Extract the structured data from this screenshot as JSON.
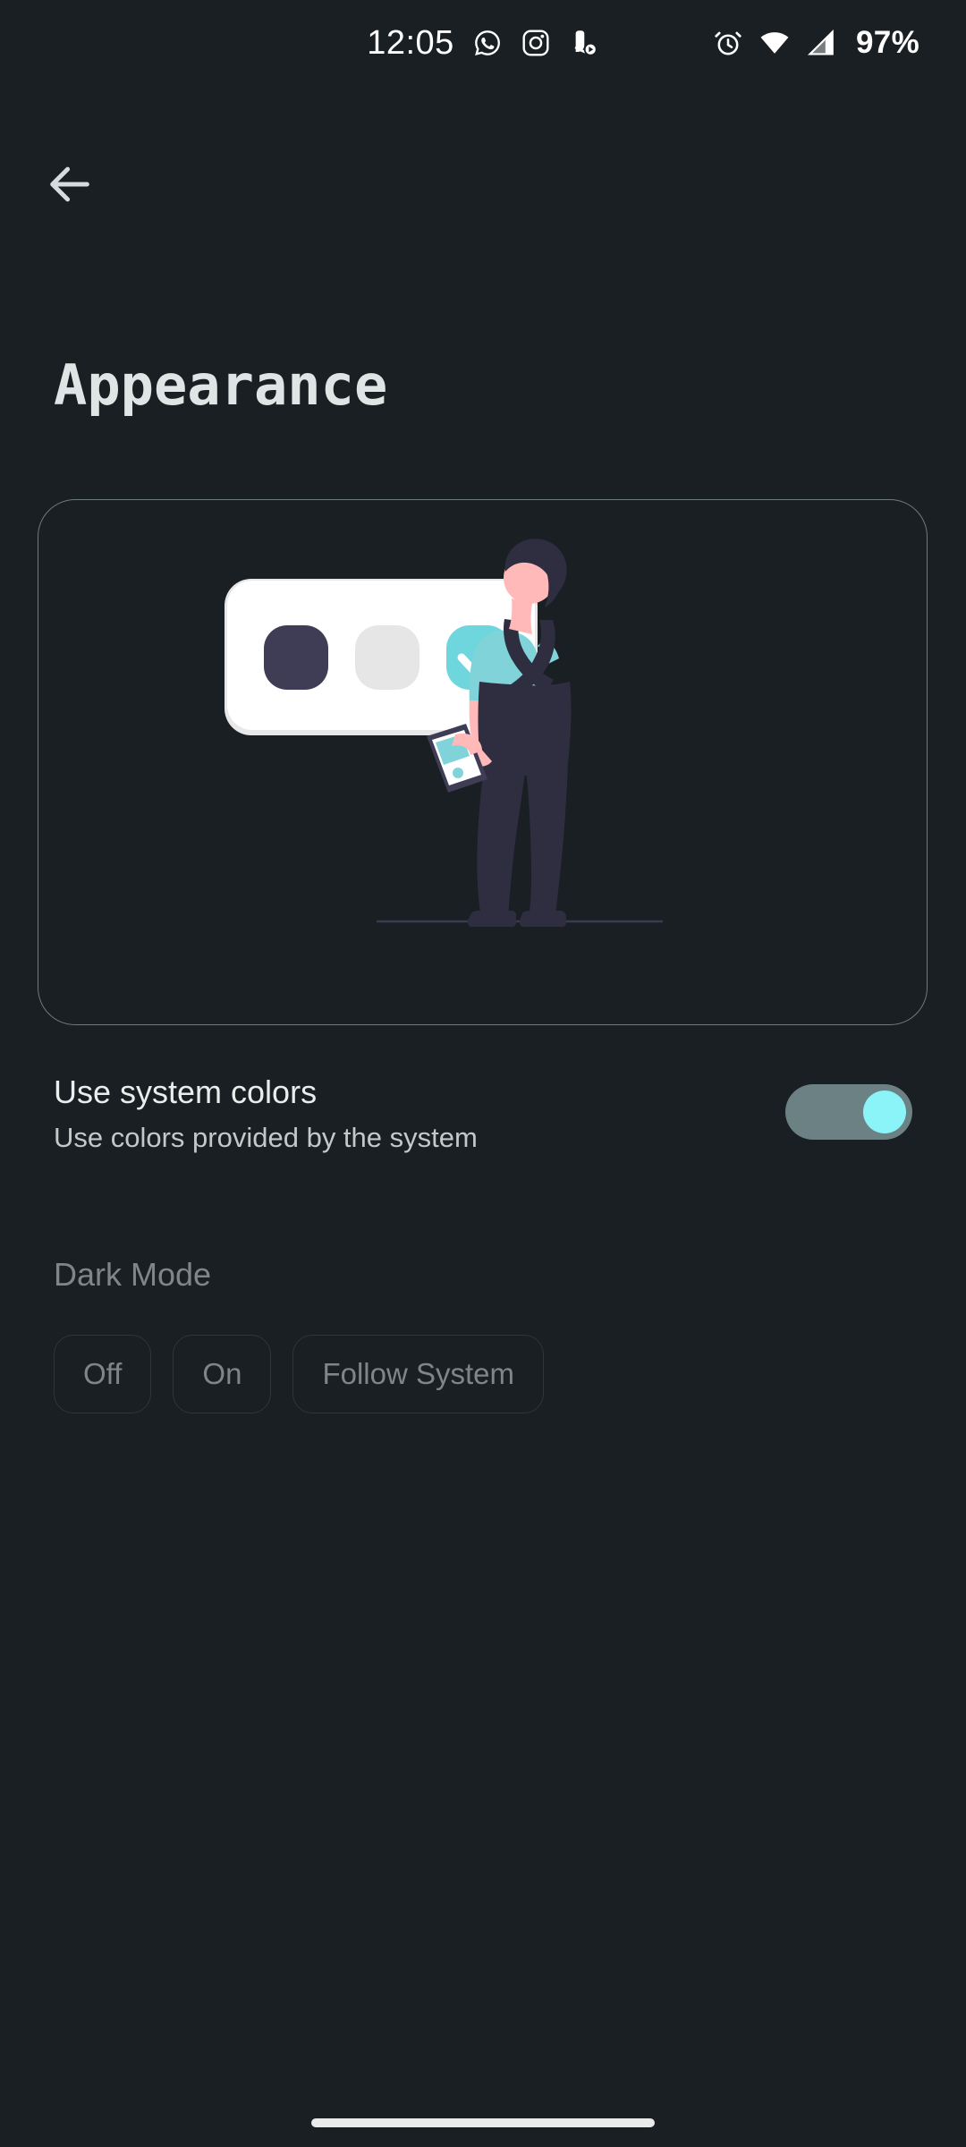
{
  "status_bar": {
    "clock": "12:05",
    "battery": "97%",
    "left_icons": [
      {
        "name": "whatsapp-icon",
        "label": "WhatsApp"
      },
      {
        "name": "instagram-icon",
        "label": "Instagram"
      },
      {
        "name": "media-player-notification-icon",
        "label": "Media player"
      }
    ],
    "right_icons": [
      {
        "name": "alarm-icon",
        "label": "Alarm set"
      },
      {
        "name": "wifi-icon",
        "label": "Wi-Fi"
      },
      {
        "name": "cellular-signal-icon",
        "label": "Cellular signal"
      }
    ]
  },
  "navigation": {
    "back_label": "Back"
  },
  "header": {
    "title": "Appearance"
  },
  "illustration": {
    "name": "appearance-theme-illustration",
    "swatches": [
      {
        "name": "dark-theme-swatch",
        "color": "#3F3D56",
        "selected": false
      },
      {
        "name": "light-theme-swatch",
        "color": "#E6E6E6",
        "selected": false
      },
      {
        "name": "accent-theme-swatch",
        "color": "#6FD6DD",
        "selected": true
      }
    ],
    "card_color": "#FFFFFF",
    "person": {
      "shirt_color": "#7FD3D9",
      "overalls_color": "#2F2E41",
      "skin_color": "#FFB9B9",
      "hair_color": "#2F2E41"
    }
  },
  "system_colors_setting": {
    "title": "Use system colors",
    "subtitle": "Use colors provided by the system",
    "toggle_state": "on",
    "track_color": "#6C8184",
    "thumb_color": "#8AF4F9"
  },
  "dark_mode_section": {
    "label": "Dark Mode",
    "enabled": false,
    "options": [
      {
        "label": "Off",
        "selected": false
      },
      {
        "label": "On",
        "selected": false
      },
      {
        "label": "Follow System",
        "selected": false
      }
    ]
  },
  "system_nav": {
    "gesture_bar": "home-gesture-bar"
  },
  "theme": {
    "background": "#191F22",
    "text_primary": "#E9EDEC",
    "text_secondary": "#C3C9C8",
    "text_disabled": "#7D8688",
    "accent": "#8AF4F9",
    "card_border": "#6E7A7C"
  }
}
